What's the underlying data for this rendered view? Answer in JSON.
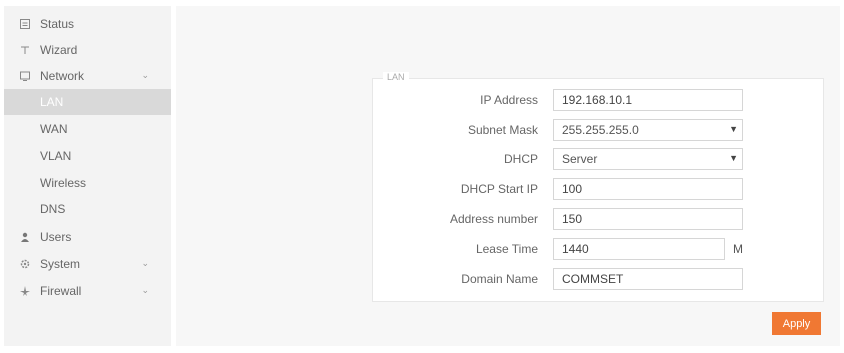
{
  "sidebar": {
    "items": [
      {
        "label": "Status",
        "icon": "status-icon"
      },
      {
        "label": "Wizard",
        "icon": "wizard-icon"
      },
      {
        "label": "Network",
        "icon": "network-icon",
        "expanded": true
      },
      {
        "label": "Users",
        "icon": "users-icon"
      },
      {
        "label": "System",
        "icon": "system-icon",
        "expanded": false
      },
      {
        "label": "Firewall",
        "icon": "firewall-icon",
        "expanded": false
      }
    ],
    "network_sub": [
      {
        "label": "LAN",
        "active": true
      },
      {
        "label": "WAN"
      },
      {
        "label": "VLAN"
      },
      {
        "label": "Wireless"
      },
      {
        "label": "DNS"
      }
    ]
  },
  "form": {
    "legend": "LAN",
    "ip_address": {
      "label": "IP Address",
      "value": "192.168.10.1"
    },
    "subnet_mask": {
      "label": "Subnet Mask",
      "value": "255.255.255.0"
    },
    "dhcp": {
      "label": "DHCP",
      "value": "Server"
    },
    "dhcp_start_ip": {
      "label": "DHCP Start IP",
      "value": "100"
    },
    "address_number": {
      "label": "Address number",
      "value": "150"
    },
    "lease_time": {
      "label": "Lease Time",
      "value": "1440",
      "unit": "M"
    },
    "domain_name": {
      "label": "Domain Name",
      "value": "COMMSET"
    }
  },
  "actions": {
    "apply_label": "Apply"
  },
  "colors": {
    "accent": "#f07833",
    "sidebar_bg": "#f3f3f3",
    "active_bg": "#d9d9d9"
  }
}
